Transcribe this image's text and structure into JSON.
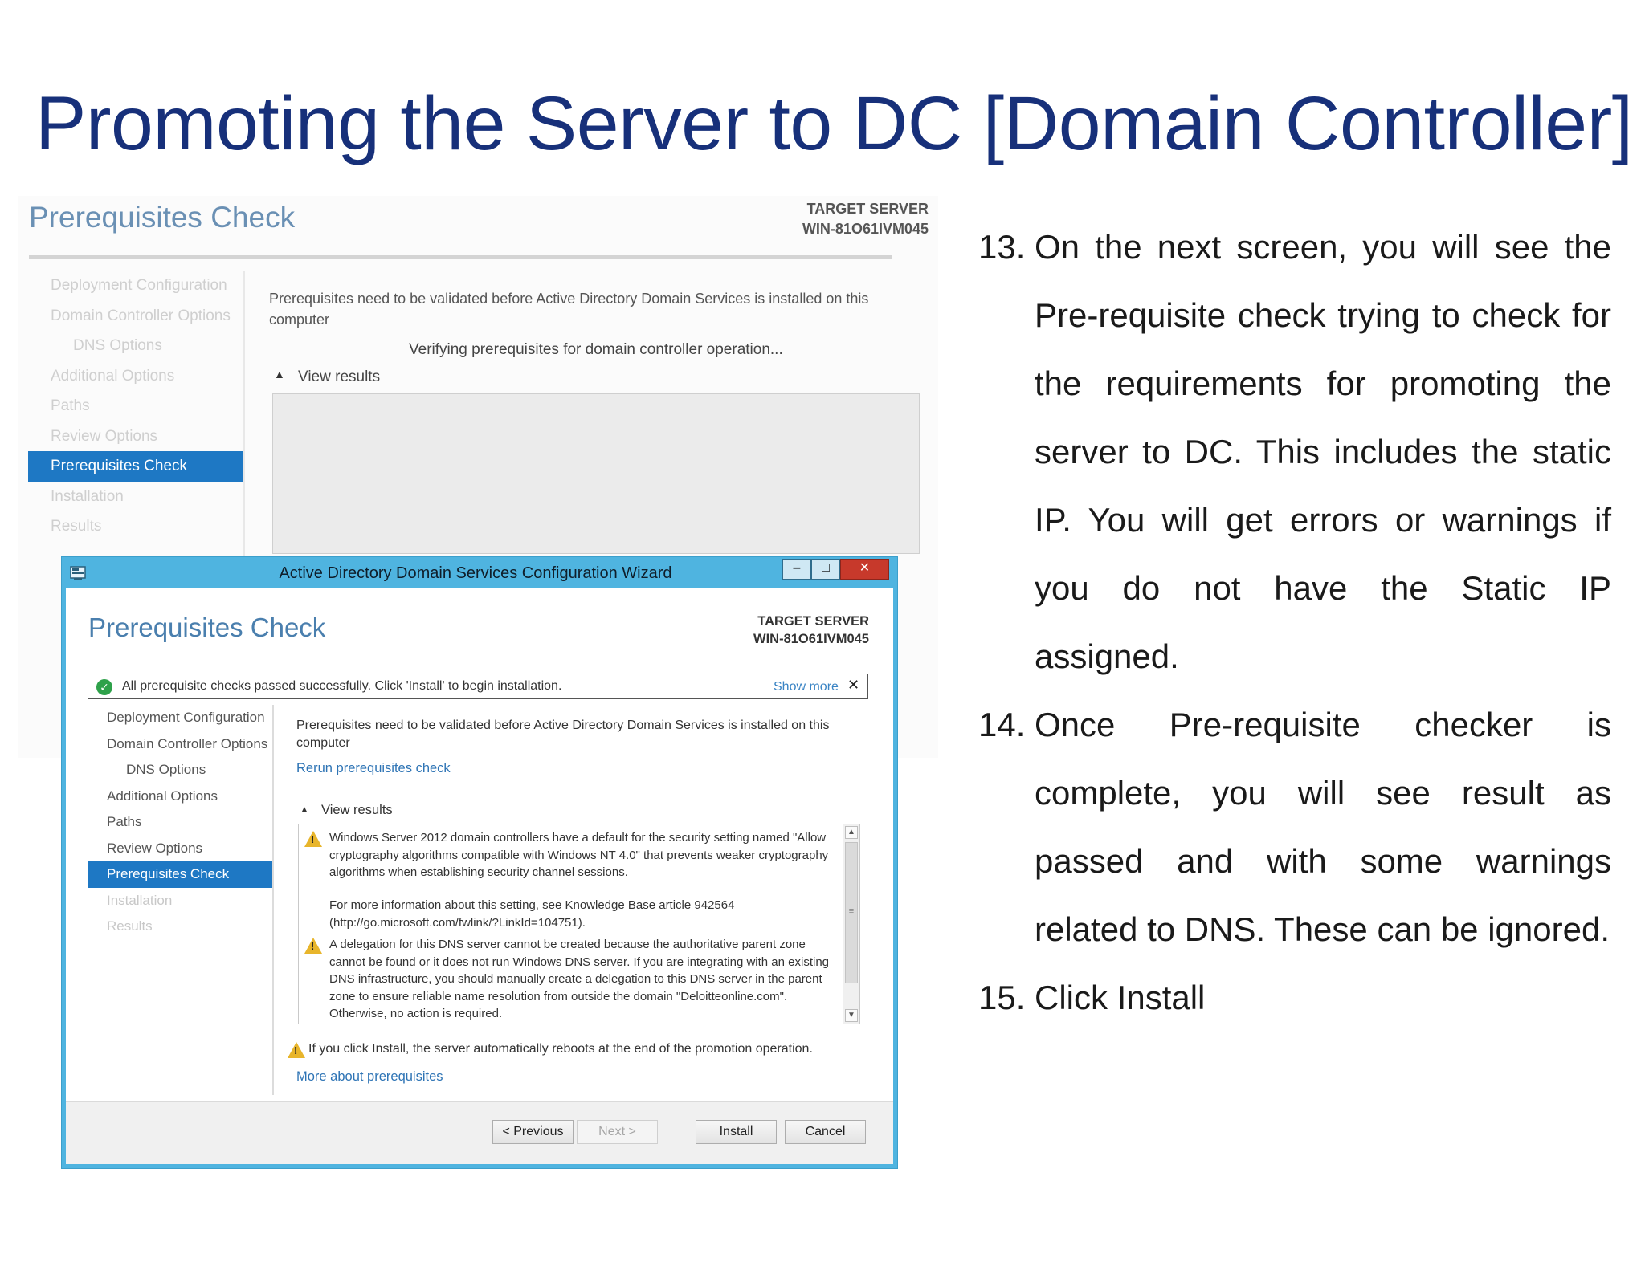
{
  "slide": {
    "title": "Promoting the Server to DC [Domain Controller]"
  },
  "background_wizard": {
    "page_title": "Prerequisites Check",
    "target_server_label": "TARGET SERVER",
    "target_server_name": "WIN-81O61IVM045",
    "nav": [
      {
        "label": "Deployment Configuration",
        "indent": false,
        "active": false
      },
      {
        "label": "Domain Controller Options",
        "indent": false,
        "active": false
      },
      {
        "label": "DNS Options",
        "indent": true,
        "active": false
      },
      {
        "label": "Additional Options",
        "indent": false,
        "active": false
      },
      {
        "label": "Paths",
        "indent": false,
        "active": false
      },
      {
        "label": "Review Options",
        "indent": false,
        "active": false
      },
      {
        "label": "Prerequisites Check",
        "indent": false,
        "active": true
      },
      {
        "label": "Installation",
        "indent": false,
        "active": false
      },
      {
        "label": "Results",
        "indent": false,
        "active": false
      }
    ],
    "description": "Prerequisites need to be validated before Active Directory Domain Services is installed on this computer",
    "verifying": "Verifying prerequisites for domain controller operation...",
    "view_results": "View results"
  },
  "wizard": {
    "window_title": "Active Directory Domain Services Configuration Wizard",
    "controls": {
      "minimize": "‒",
      "maximize": "□",
      "close": "✕"
    },
    "page_title": "Prerequisites Check",
    "target_server_label": "TARGET SERVER",
    "target_server_name": "WIN-81O61IVM045",
    "banner": {
      "message": "All prerequisite checks passed successfully.  Click 'Install' to begin installation.",
      "show_more": "Show more",
      "close": "✕"
    },
    "nav": [
      {
        "label": "Deployment Configuration",
        "state": "normal"
      },
      {
        "label": "Domain Controller Options",
        "state": "normal"
      },
      {
        "label": "DNS Options",
        "state": "indent"
      },
      {
        "label": "Additional Options",
        "state": "normal"
      },
      {
        "label": "Paths",
        "state": "normal"
      },
      {
        "label": "Review Options",
        "state": "normal"
      },
      {
        "label": "Prerequisites Check",
        "state": "active"
      },
      {
        "label": "Installation",
        "state": "disabled"
      },
      {
        "label": "Results",
        "state": "disabled"
      }
    ],
    "description": "Prerequisites need to be validated before Active Directory Domain Services is installed on this computer",
    "rerun_link": "Rerun prerequisites check",
    "view_results": "View results",
    "results": [
      {
        "icon": "warning-icon",
        "text": "Windows Server 2012 domain controllers have a default for the security setting named \"Allow cryptography algorithms compatible with Windows NT 4.0\" that prevents weaker cryptography algorithms when establishing security channel sessions."
      },
      {
        "icon": "",
        "text": "For more information about this setting, see Knowledge Base article 942564 (http://go.microsoft.com/fwlink/?LinkId=104751)."
      },
      {
        "icon": "warning-icon",
        "text": "A delegation for this DNS server cannot be created because the authoritative parent zone cannot be found or it does not run Windows DNS server. If you are integrating with an existing DNS infrastructure, you should manually create a delegation to this DNS server in the parent zone to ensure reliable name resolution from outside the domain \"Deloitteonline.com\". Otherwise, no action is required."
      }
    ],
    "reboot_warning": "If you click Install, the server automatically reboots at the end of the promotion operation.",
    "more_link": "More about prerequisites",
    "buttons": {
      "previous": "< Previous",
      "next": "Next >",
      "install": "Install",
      "cancel": "Cancel"
    }
  },
  "steps": [
    {
      "number": "13.",
      "text": "On the next screen, you will see the Pre-requisite check trying to check for the requirements for promoting the server to DC. This includes the static IP. You will get errors or warnings if you do not have the Static IP assigned."
    },
    {
      "number": "14.",
      "text": "Once Pre-requisite checker is complete, you will see result as passed and with some warnings related to DNS. These can be ignored."
    },
    {
      "number": "15.",
      "text": "Click Install"
    }
  ],
  "colors": {
    "title": "#17307a",
    "window_frame": "#4fb4e0",
    "nav_active": "#1e78c4",
    "link": "#2e74b5",
    "success": "#2ea14a",
    "warning": "#e8b52b",
    "close_button": "#c7392b"
  }
}
